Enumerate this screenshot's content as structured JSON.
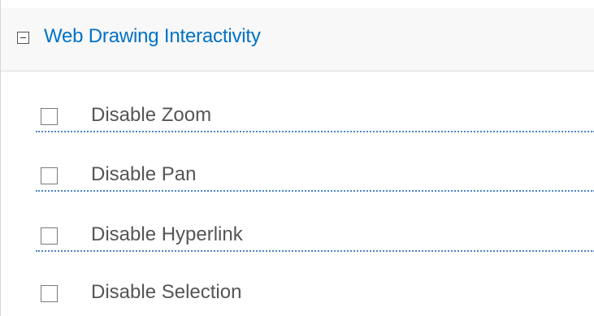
{
  "section": {
    "title": "Web Drawing Interactivity",
    "toggle_icon": "collapse-minus-icon",
    "accent_color": "#0072c6"
  },
  "options": [
    {
      "label": "Disable Zoom",
      "checked": false
    },
    {
      "label": "Disable Pan",
      "checked": false
    },
    {
      "label": "Disable Hyperlink",
      "checked": false
    },
    {
      "label": "Disable Selection",
      "checked": false
    }
  ]
}
